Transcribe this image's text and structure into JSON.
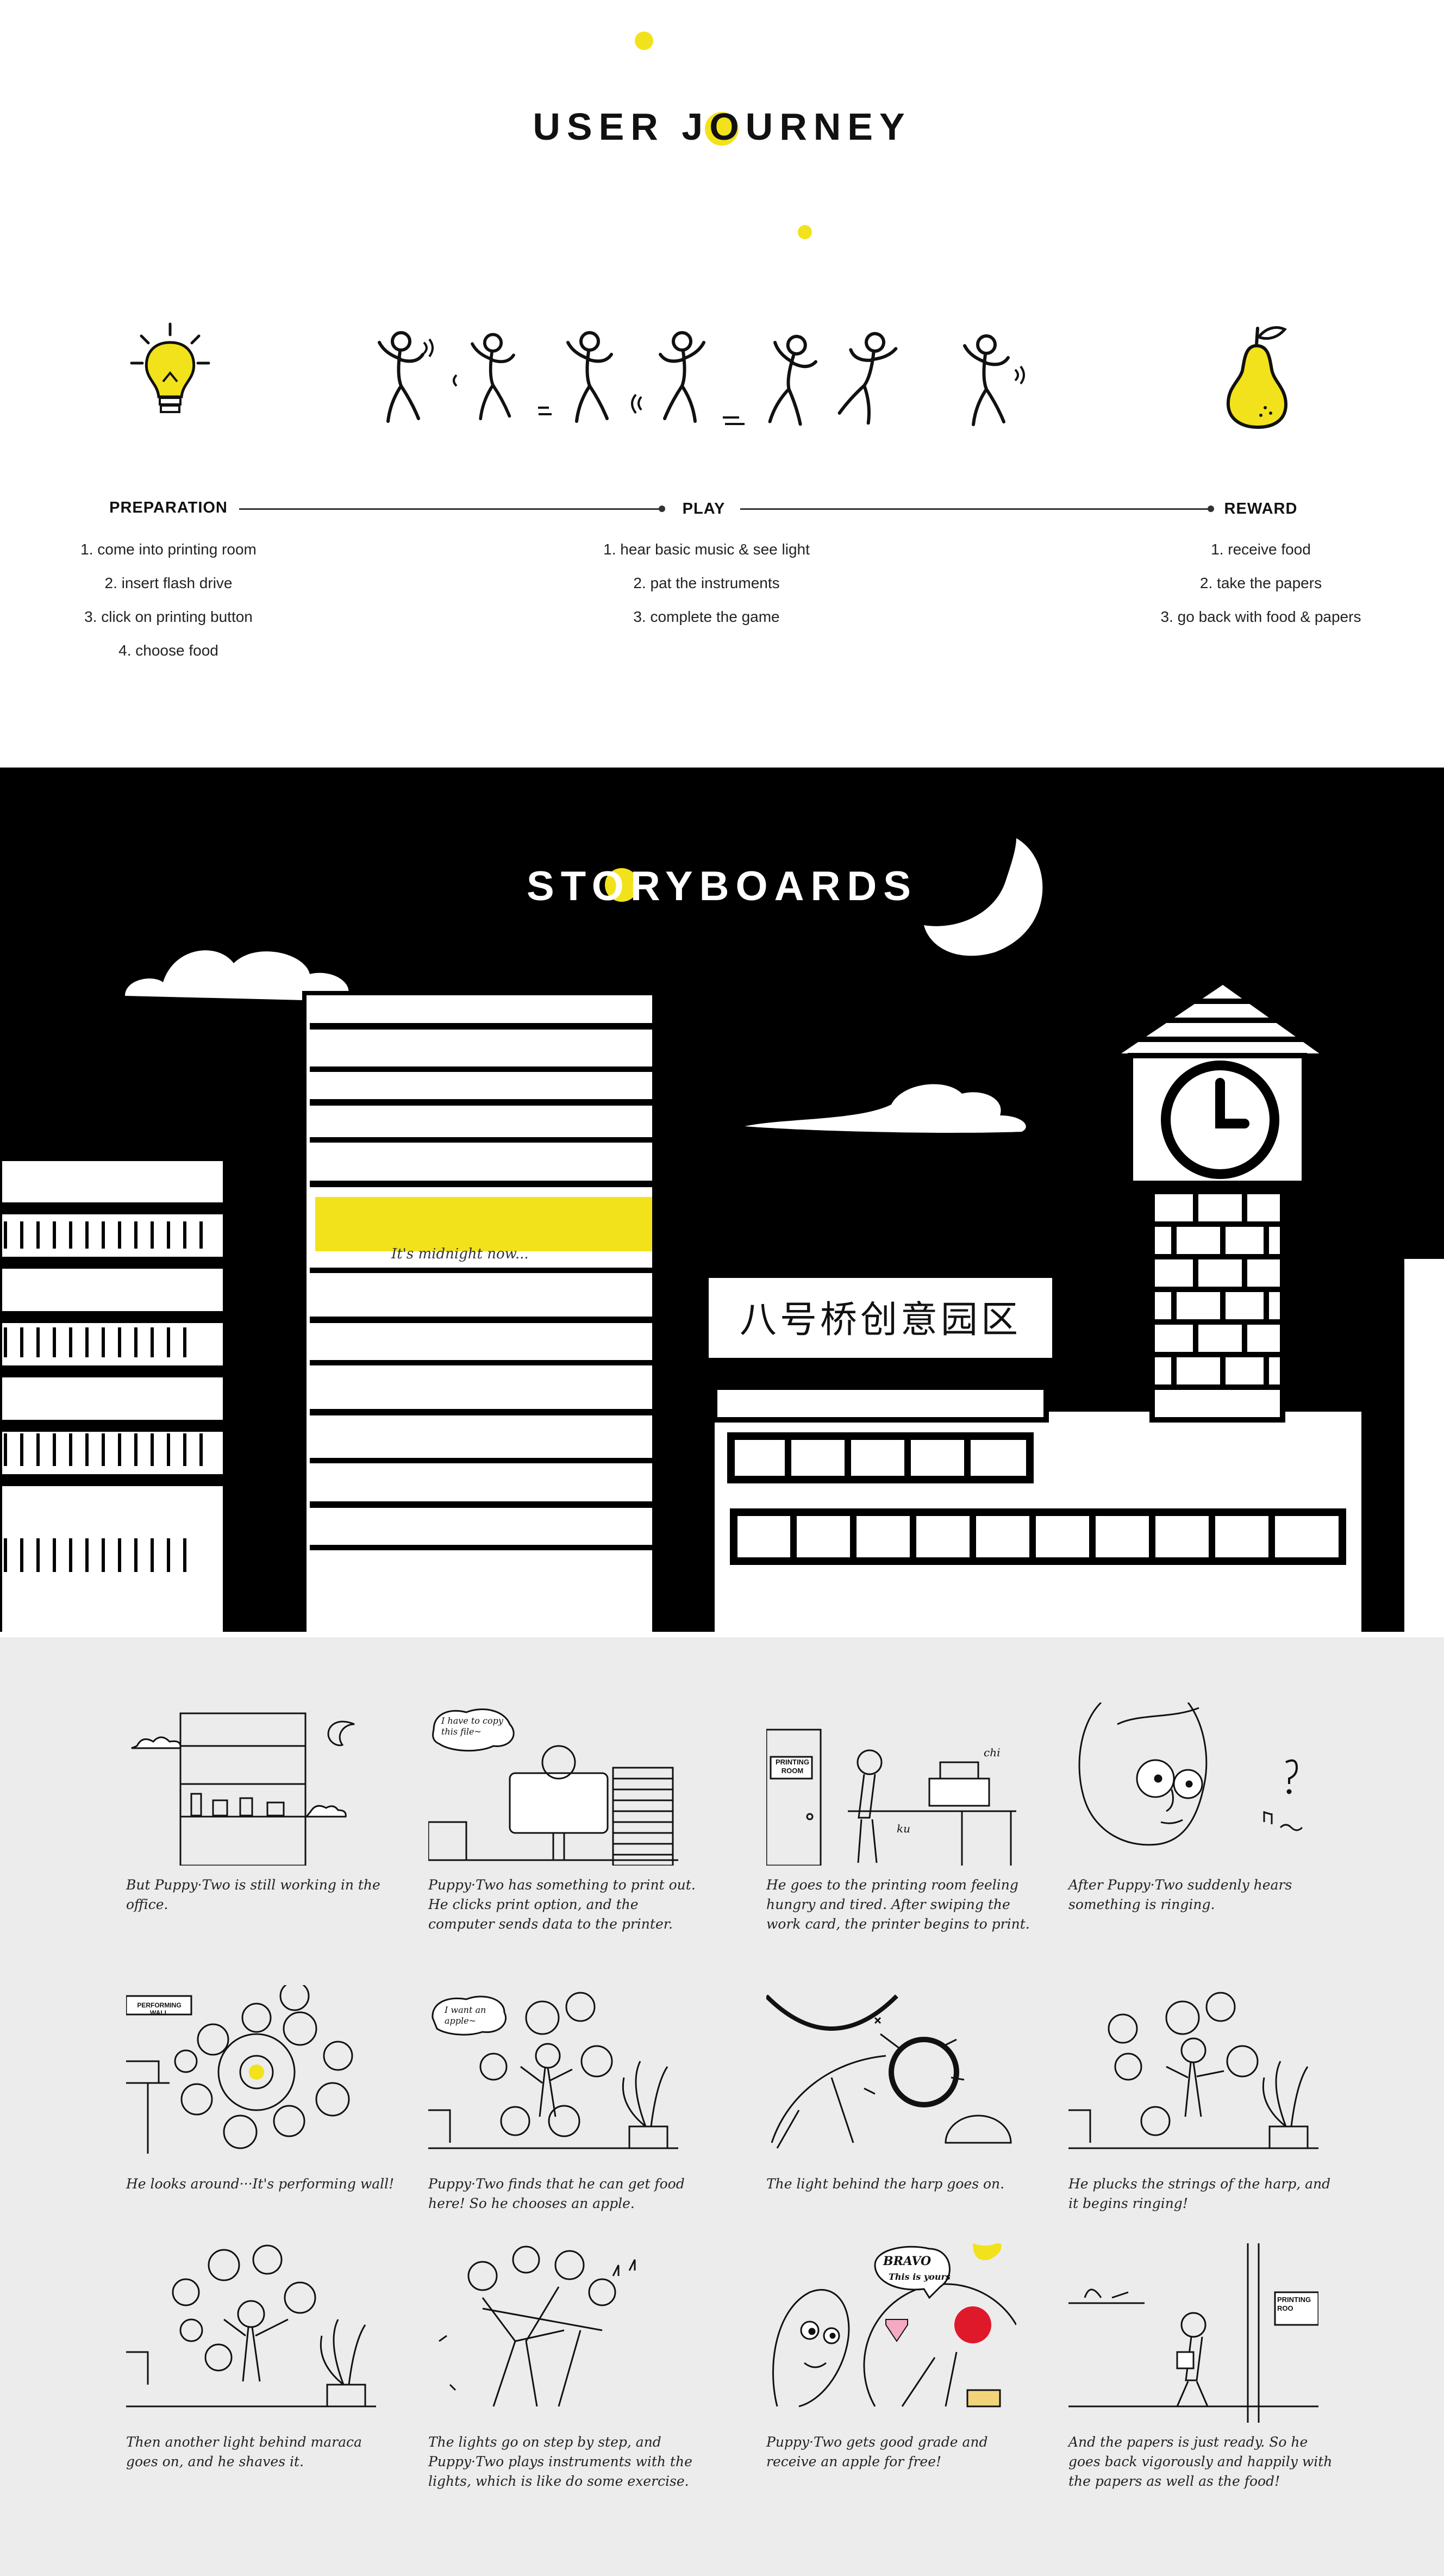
{
  "journey": {
    "title": "USER JOURNEY",
    "phases": [
      {
        "label": "PREPARATION",
        "steps": [
          "1. come into printing room",
          "2. insert flash drive",
          "3. click on printing button",
          "4. choose food"
        ]
      },
      {
        "label": "PLAY",
        "steps": [
          "1. hear basic music & see light",
          "2. pat the instruments",
          "3. complete the game"
        ]
      },
      {
        "label": "REWARD",
        "steps": [
          "1. receive food",
          "2. take the papers",
          "3. go back with food & papers"
        ]
      }
    ],
    "icons": [
      "lightbulb-icon",
      "dancer-icon",
      "pear-icon"
    ],
    "accent": "#f2e21b"
  },
  "storyboard": {
    "title": "STORYBOARDS",
    "window_text": "It's midnight now...",
    "sign_text": "八号桥创意园区"
  },
  "panels": [
    {
      "caption": "But Puppy·Two is still working in the office."
    },
    {
      "caption": "Puppy·Two has something to print out. He clicks print option, and the computer sends data to the printer.",
      "bubble": "I have to copy this file~"
    },
    {
      "caption": "He goes to the printing room feeling hungry and tired. After swiping the work card, the printer begins to print.",
      "door_sign": "PRINTING ROOM",
      "sound1": "chi",
      "sound2": "ku"
    },
    {
      "caption": "After Puppy·Two suddenly hears something is ringing."
    },
    {
      "caption": "He looks around···It's performing wall!",
      "door_sign": "PERFORMING WALL"
    },
    {
      "caption": "Puppy·Two finds that he can get food here! So he chooses an apple.",
      "bubble": "I want an apple~"
    },
    {
      "caption": "The light behind the harp goes on."
    },
    {
      "caption": "He plucks the strings of the harp, and it begins ringing!"
    },
    {
      "caption": "Then another light behind maraca goes on, and he shaves it."
    },
    {
      "caption": "The lights go on step by step, and Puppy·Two plays instruments with the lights, which is like do some exercise."
    },
    {
      "caption": "Puppy·Two gets good grade and receive an apple for free!",
      "bubble1": "BRAVO",
      "bubble2": "This is yours"
    },
    {
      "caption": "And the papers is just ready. So he goes back vigorously and happily with the papers as well as the food!",
      "door_sign": "PRINTING ROO"
    }
  ]
}
